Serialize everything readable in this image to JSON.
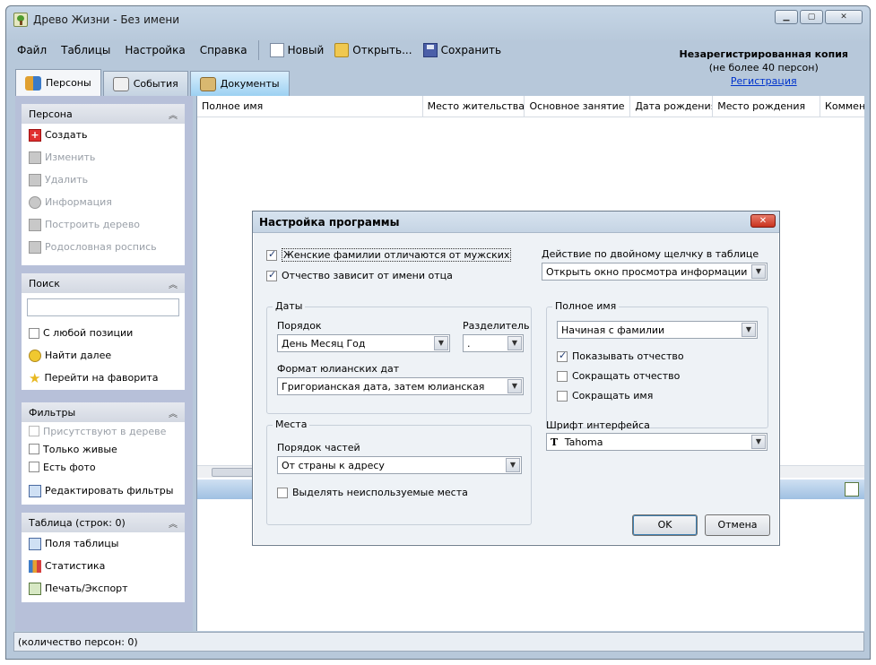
{
  "window": {
    "title": "Древо Жизни - Без имени"
  },
  "menu": {
    "items": [
      "Файл",
      "Таблицы",
      "Настройка",
      "Справка"
    ]
  },
  "toolbar": {
    "new_label": "Новый",
    "open_label": "Открыть...",
    "save_label": "Сохранить"
  },
  "unregistered": {
    "title": "Незарегистрированная копия",
    "limit": "(не более 40 персон)",
    "link": "Регистрация"
  },
  "tabs": [
    {
      "label": "Персоны"
    },
    {
      "label": "События"
    },
    {
      "label": "Документы"
    }
  ],
  "sidebar": {
    "person": {
      "header": "Персона",
      "items": [
        "Создать",
        "Изменить",
        "Удалить",
        "Информация",
        "Построить дерево",
        "Родословная роспись"
      ]
    },
    "search": {
      "header": "Поиск",
      "input_value": "",
      "any_position": "С любой позиции",
      "find_next": "Найти далее",
      "goto_favorite": "Перейти на фаворита"
    },
    "filters": {
      "header": "Фильтры",
      "in_tree": "Присутствуют в дереве",
      "only_alive": "Только живые",
      "has_photo": "Есть фото",
      "edit_filters": "Редактировать фильтры"
    },
    "table": {
      "header": "Таблица (строк: 0)",
      "fields": "Поля таблицы",
      "stats": "Статистика",
      "print": "Печать/Экспорт"
    }
  },
  "grid": {
    "columns": [
      "Полное имя",
      "Место жительства",
      "Основное занятие",
      "Дата рождения",
      "Место рождения",
      "Коммент"
    ]
  },
  "status": {
    "text": "(количество персон: 0)"
  },
  "dialog": {
    "title": "Настройка программы",
    "female_surnames": "Женские фамилии отличаются от мужских",
    "patronymic_depends": "Отчество зависит от имени отца",
    "dblclick_label": "Действие по двойному щелчку в таблице",
    "dblclick_value": "Открыть окно просмотра информации",
    "dates_legend": "Даты",
    "order_label": "Порядок",
    "order_value": "День Месяц Год",
    "separator_label": "Разделитель",
    "separator_value": ".",
    "julian_label": "Формат юлианских дат",
    "julian_value": "Григорианская дата, затем юлианская",
    "fullname_legend": "Полное имя",
    "fullname_value": "Начиная с фамилии",
    "show_patronymic": "Показывать отчество",
    "shorten_patronymic": "Сокращать отчество",
    "shorten_name": "Сокращать имя",
    "places_legend": "Места",
    "parts_order_label": "Порядок частей",
    "parts_order_value": "От страны к адресу",
    "highlight_unused": "Выделять неиспользуемые места",
    "font_label": "Шрифт интерфейса",
    "font_value": "Tahoma",
    "ok": "OK",
    "cancel": "Отмена"
  }
}
